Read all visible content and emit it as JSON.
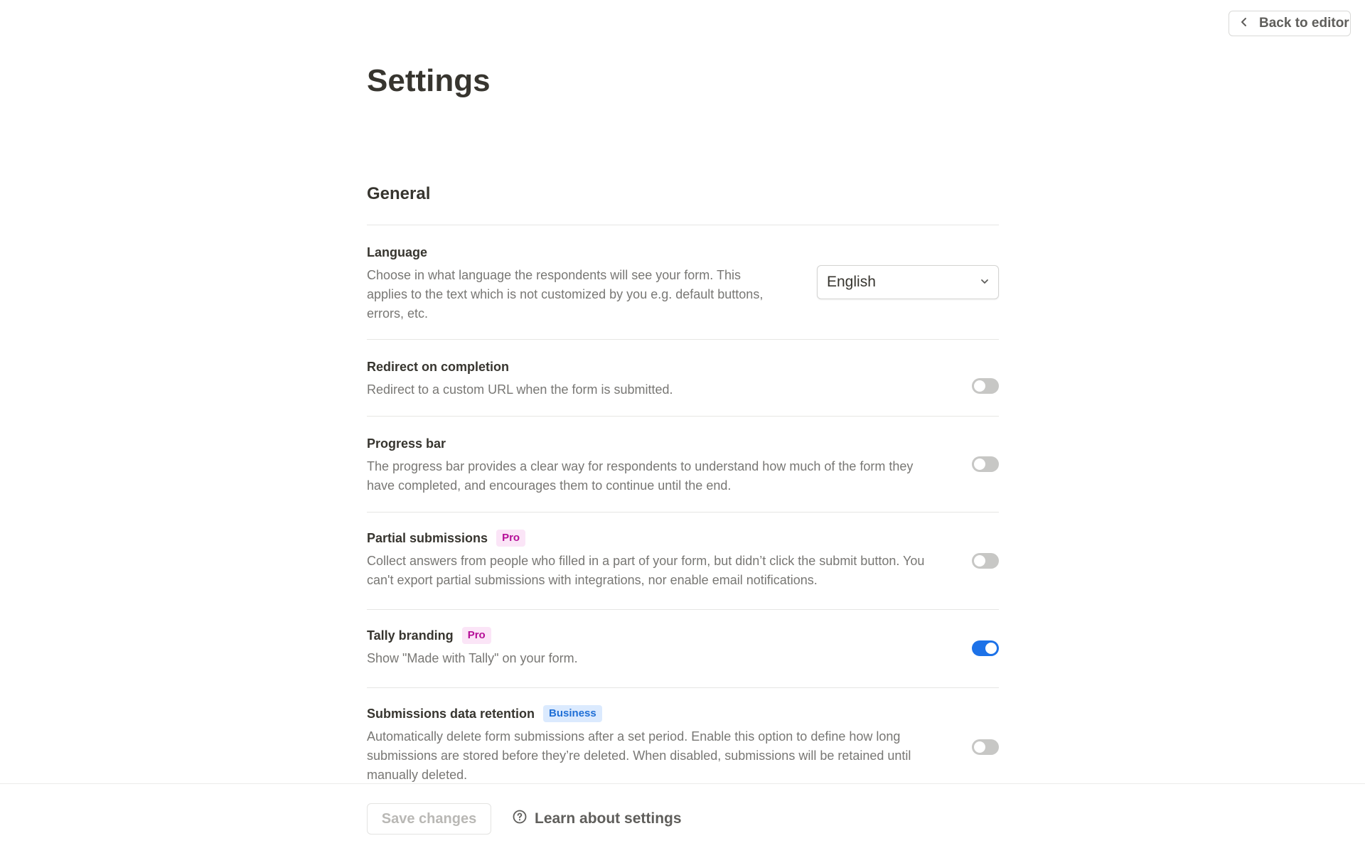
{
  "header": {
    "back_label": "Back to editor"
  },
  "page": {
    "title": "Settings",
    "section": "General"
  },
  "settings": {
    "language": {
      "label": "Language",
      "description": "Choose in what language the respondents will see your form. This applies to the text which is not customized by you e.g. default buttons, errors, etc.",
      "selected": "English"
    },
    "redirect": {
      "label": "Redirect on completion",
      "description": "Redirect to a custom URL when the form is submitted.",
      "enabled": false
    },
    "progress": {
      "label": "Progress bar",
      "description": "The progress bar provides a clear way for respondents to understand how much of the form they have completed, and encourages them to continue until the end.",
      "enabled": false
    },
    "partial": {
      "label": "Partial submissions",
      "badge": "Pro",
      "description": "Collect answers from people who filled in a part of your form, but didn’t click the submit button. You can't export partial submissions with integrations, nor enable email notifications.",
      "enabled": false
    },
    "branding": {
      "label": "Tally branding",
      "badge": "Pro",
      "description": "Show \"Made with Tally\" on your form.",
      "enabled": true
    },
    "retention": {
      "label": "Submissions data retention",
      "badge": "Business",
      "description": "Automatically delete form submissions after a set period. Enable this option to define how long submissions are stored before they’re deleted. When disabled, submissions will be retained until manually deleted.",
      "enabled": false
    }
  },
  "footer": {
    "save_label": "Save changes",
    "learn_label": "Learn about settings"
  },
  "colors": {
    "toggle_on": "#1d72e8",
    "toggle_off": "#c7c7c5",
    "badge_pro_bg": "#fbe5f7",
    "badge_pro_text": "#b50e97",
    "badge_business_bg": "#dbeafe",
    "badge_business_text": "#1f6fd6"
  },
  "icons": {
    "back": "chevron-left-icon",
    "select": "chevron-down-icon",
    "help": "question-circle-icon"
  }
}
